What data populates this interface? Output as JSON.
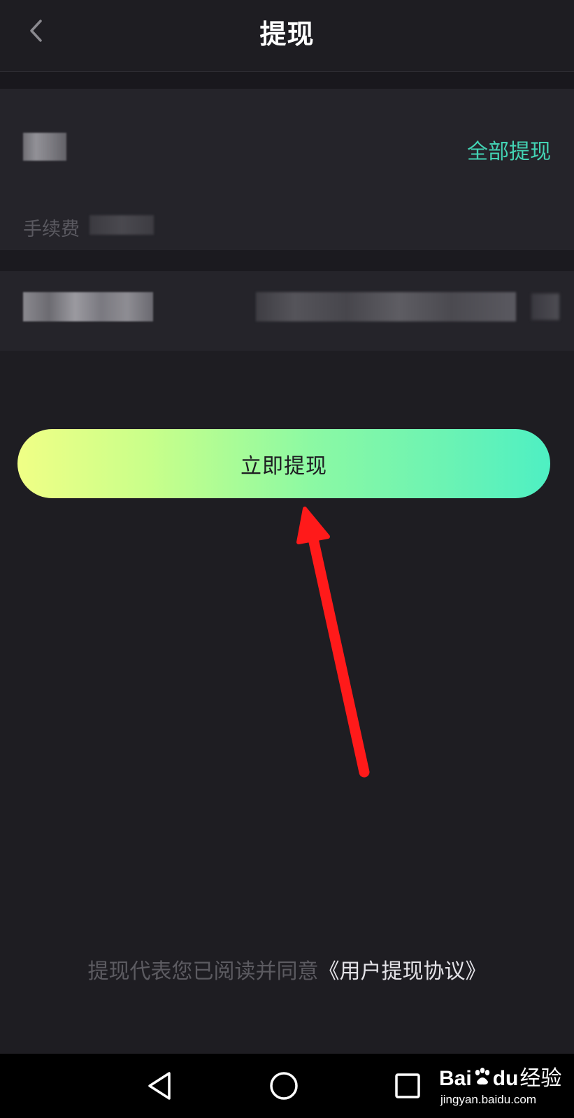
{
  "header": {
    "title": "提现",
    "back_icon": "chevron-left-icon"
  },
  "balance_card": {
    "withdraw_all_label": "全部提现",
    "fee_label": "手续费"
  },
  "primary_button": {
    "label": "立即提现"
  },
  "agreement": {
    "prefix": "提现代表您已阅读并同意",
    "link": "《用户提现协议》"
  },
  "navbar": {
    "back_icon": "triangle-back-icon",
    "home_icon": "circle-home-icon",
    "recents_icon": "square-recents-icon"
  },
  "watermark": {
    "brand": "Bai",
    "brand_suffix": "du",
    "brand_cn": "经验",
    "site": "jingyan.baidu.com"
  },
  "colors": {
    "background": "#1e1d22",
    "card": "#25242a",
    "accent": "#43d3b4",
    "button_gradient_start": "#f0ff86",
    "button_gradient_end": "#4ef0c3",
    "annotation_arrow": "#ff1a1a"
  }
}
